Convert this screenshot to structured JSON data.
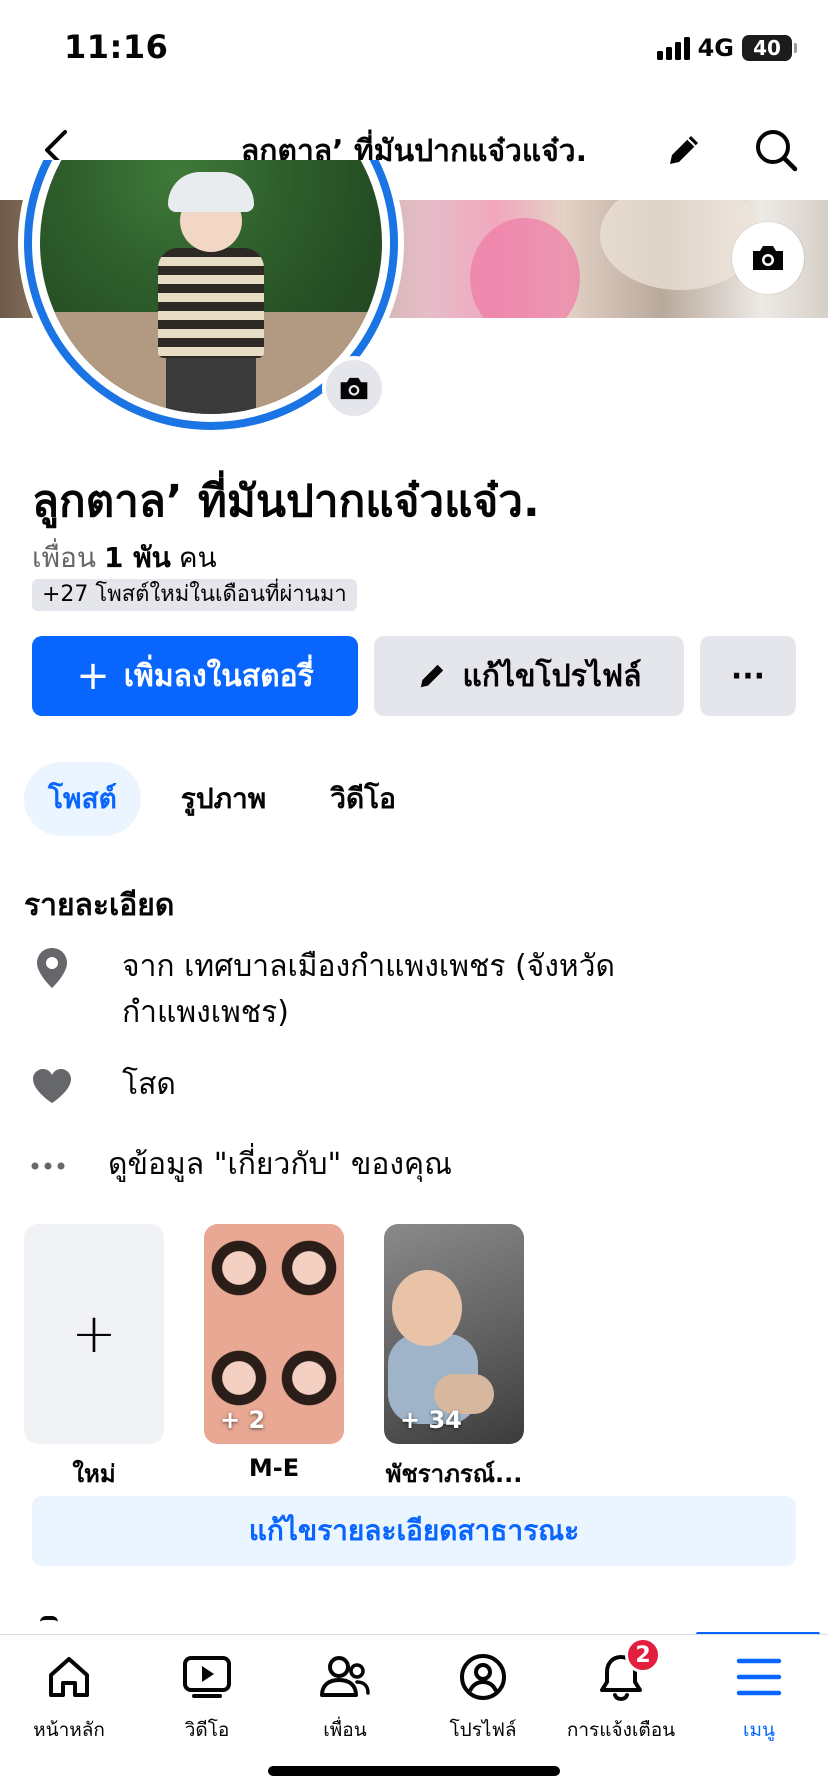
{
  "status_bar": {
    "time": "11:16",
    "network": "4G",
    "battery": "40"
  },
  "nav": {
    "title": "ลูกตาล’ ที่มันปากแจ๋วแจ๋ว."
  },
  "profile": {
    "name": "ลูกตาล’ ที่มันปากแจ๋วแจ๋ว.",
    "friends_label": "เพื่อน",
    "friends_count": "1 พัน",
    "friends_unit": "คน",
    "posts_badge": "+27 โพสต์ใหม่ในเดือนที่ผ่านมา"
  },
  "actions": {
    "add_story_label": "เพิ่มลงในสตอรี่",
    "edit_profile_label": "แก้ไขโปรไฟล์",
    "more_label": "···"
  },
  "tabs": [
    {
      "label": "โพสต์",
      "active": true
    },
    {
      "label": "รูปภาพ",
      "active": false
    },
    {
      "label": "วิดีโอ",
      "active": false
    }
  ],
  "details": {
    "title": "รายละเอียด",
    "hometown_line1": "จาก เทศบาลเมืองกำแพงเพชร (จังหวัด",
    "hometown_line2": "กำแพงเพชร)",
    "relationship": "โสด",
    "see_about": "ดูข้อมูล \"เกี่ยวกับ\" ของคุณ"
  },
  "featured": [
    {
      "label": "ใหม่",
      "count": ""
    },
    {
      "label": "M-E",
      "count": "+ 2"
    },
    {
      "label": "พัชราภรณ์...",
      "count": "+ 34"
    }
  ],
  "edit_public_label": "แก้ไขรายละเอียดสาธารณะ",
  "tabbar": [
    {
      "label": "หน้าหลัก",
      "icon": "home-icon"
    },
    {
      "label": "วิดีโอ",
      "icon": "video-icon"
    },
    {
      "label": "เพื่อน",
      "icon": "friends-icon"
    },
    {
      "label": "โปรไฟล์",
      "icon": "profile-icon"
    },
    {
      "label": "การแจ้งเตือน",
      "icon": "bell-icon",
      "badge": "2"
    },
    {
      "label": "เมนู",
      "icon": "menu-icon",
      "active": true
    }
  ],
  "colors": {
    "accent": "#0866ff",
    "badge": "#e41e3f",
    "ring": "#1b74e4"
  }
}
